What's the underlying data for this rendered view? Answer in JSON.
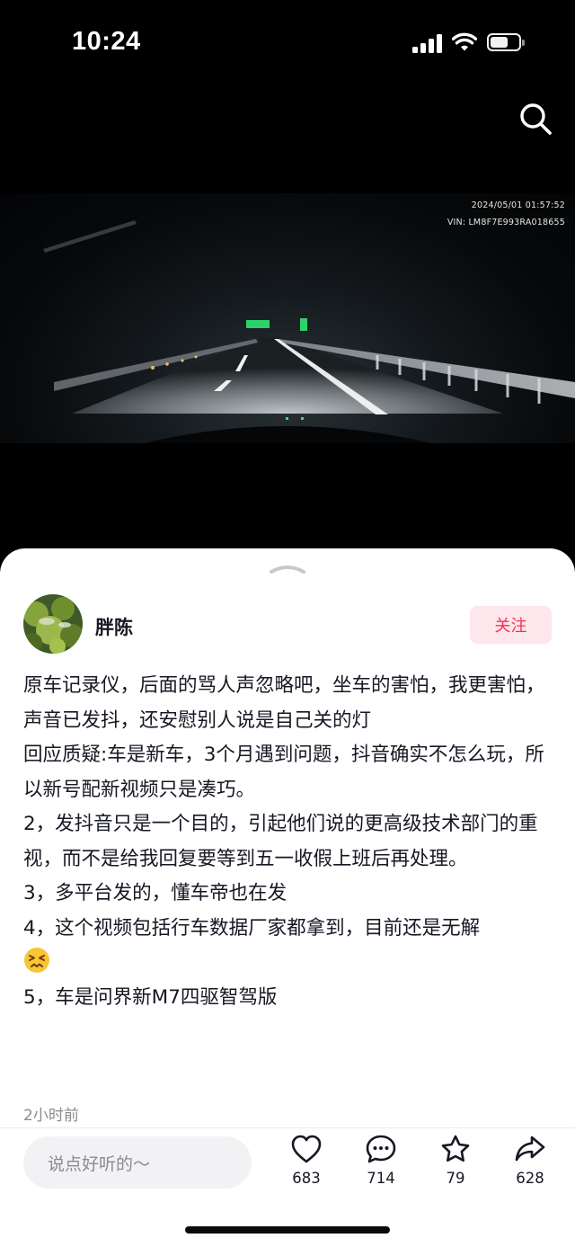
{
  "status_bar": {
    "time": "10:24",
    "battery_level": 0.62
  },
  "video": {
    "timestamp": "2024/05/01  01:57:52",
    "vin": "VIN: LM8F7E993RA018655"
  },
  "post": {
    "author": "胖陈",
    "follow_label": "关注",
    "paragraphs": [
      "原车记录仪，后面的骂人声忽略吧，坐车的害怕，我更害怕，声音已发抖，还安慰别人说是自己关的灯",
      "回应质疑:车是新车，3个月遇到问题，抖音确实不怎么玩，所以新号配新视频只是凑巧。",
      "2，发抖音只是一个目的，引起他们说的更高级技术部门的重视，而不是给我回复要等到五一收假上班后再处理。",
      "3，多平台发的，懂车帝也在发",
      "4，这个视频包括行车数据厂家都拿到，目前还是无解",
      "5，车是问界新M7四驱智驾版"
    ],
    "time_ago": "2小时前"
  },
  "bottom_bar": {
    "comment_placeholder": "说点好听的～",
    "like_count": "683",
    "comment_count": "714",
    "favorite_count": "79",
    "share_count": "628"
  },
  "colors": {
    "accent": "#fe2c55",
    "follow_bg": "#fde7ec"
  }
}
